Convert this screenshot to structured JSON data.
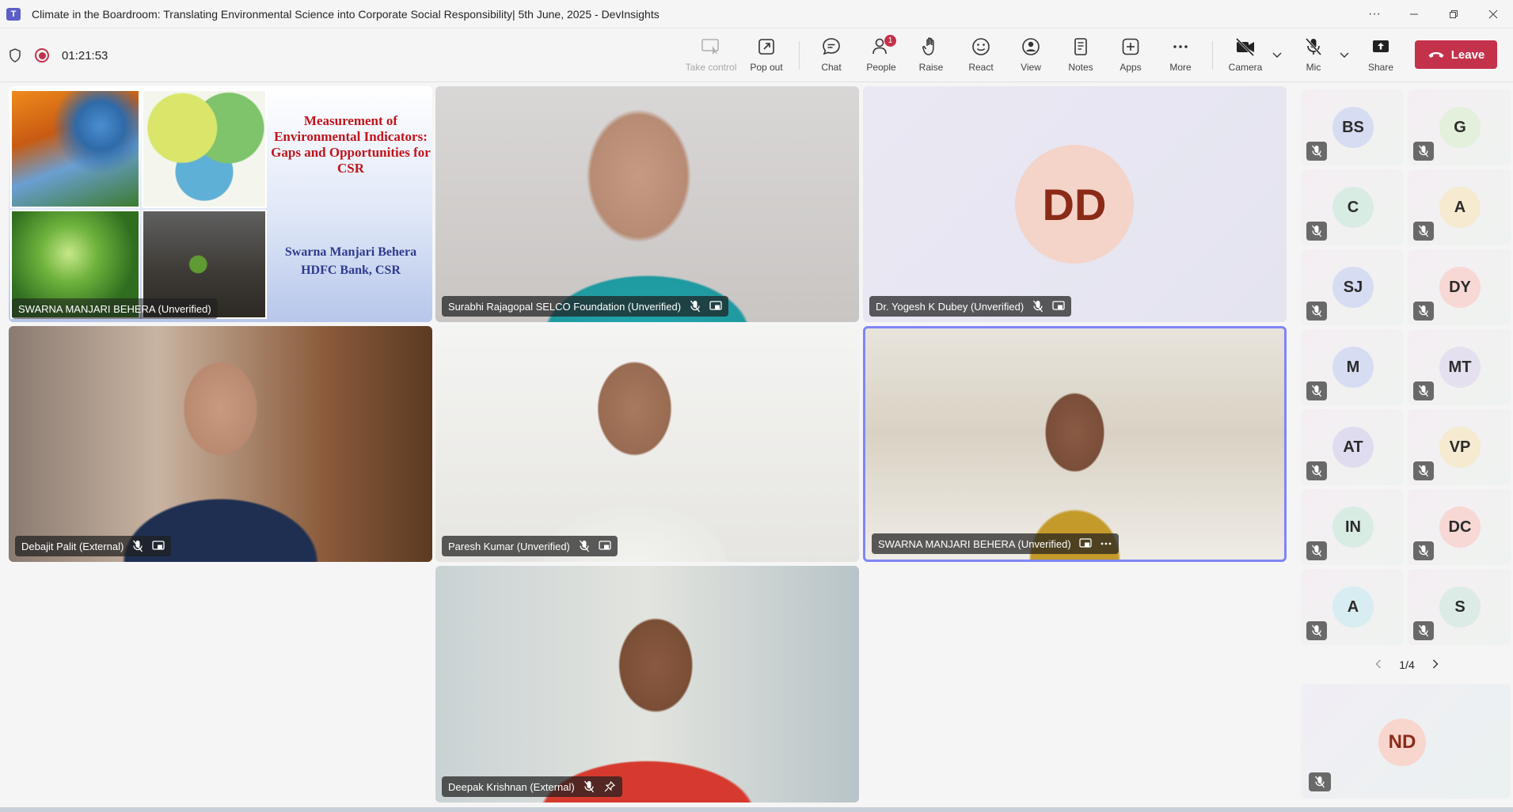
{
  "window": {
    "title": "Climate in the Boardroom: Translating Environmental Science into Corporate Social Responsibility| 5th June, 2025 - DevInsights",
    "app_logo_text": "T"
  },
  "meeting": {
    "timer": "01:21:53"
  },
  "toolbar": {
    "take_control": "Take control",
    "pop_out": "Pop out",
    "chat": "Chat",
    "people": "People",
    "people_badge": "1",
    "raise": "Raise",
    "react": "React",
    "view": "View",
    "notes": "Notes",
    "apps": "Apps",
    "more": "More",
    "camera": "Camera",
    "mic": "Mic",
    "share": "Share",
    "leave": "Leave"
  },
  "slide": {
    "title": "Measurement of Environmental Indicators: Gaps and Opportunities for CSR",
    "author_line1": "Swarna Manjari Behera",
    "author_line2": "HDFC Bank, CSR"
  },
  "tiles": {
    "presenter_screen": {
      "name": "SWARNA MANJARI BEHERA (Unverified)"
    },
    "surabhi": {
      "name": "Surabhi Rajagopal SELCO Foundation (Unverified)"
    },
    "yogesh": {
      "name": "Dr. Yogesh K Dubey (Unverified)",
      "initials": "DD"
    },
    "debajit": {
      "name": "Debajit Palit (External)"
    },
    "paresh": {
      "name": "Paresh Kumar (Unverified)"
    },
    "swarna": {
      "name": "SWARNA MANJARI BEHERA (Unverified)"
    },
    "deepak": {
      "name": "Deepak Krishnan (External)"
    }
  },
  "rail": {
    "participants": [
      {
        "initials": "BS",
        "color": "#d6dcf2"
      },
      {
        "initials": "G",
        "color": "#e3f0dc"
      },
      {
        "initials": "C",
        "color": "#d9ece4"
      },
      {
        "initials": "A",
        "color": "#f6ead0"
      },
      {
        "initials": "SJ",
        "color": "#d6dcf2"
      },
      {
        "initials": "DY",
        "color": "#f8d8d4"
      },
      {
        "initials": "M",
        "color": "#d6dcf2"
      },
      {
        "initials": "MT",
        "color": "#e4e0ef"
      },
      {
        "initials": "AT",
        "color": "#e0dcf0"
      },
      {
        "initials": "VP",
        "color": "#f6ead0"
      },
      {
        "initials": "IN",
        "color": "#d9ece4"
      },
      {
        "initials": "DC",
        "color": "#f8d8d4"
      },
      {
        "initials": "A",
        "color": "#d7edf2"
      },
      {
        "initials": "S",
        "color": "#dcebe6"
      }
    ],
    "pager": "1/4",
    "bottom_participant": {
      "initials": "ND"
    }
  }
}
